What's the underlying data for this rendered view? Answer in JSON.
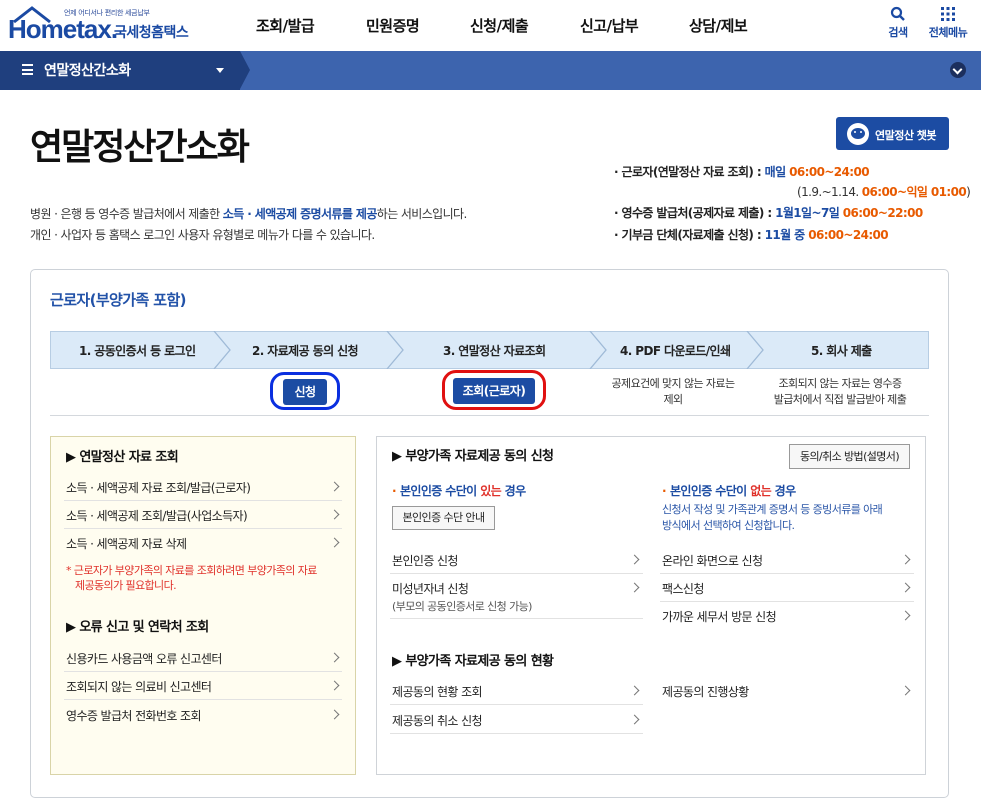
{
  "header": {
    "logo_small": "언제 어디서나 편리한 세금납부",
    "logo_brand": "Hometax.",
    "logo_kr": "국세청홈택스",
    "menu": [
      "조회/발급",
      "민원증명",
      "신청/제출",
      "신고/납부",
      "상담/제보"
    ],
    "search_label": "검색",
    "allmenu_label": "전체메뉴"
  },
  "nav": {
    "current": "연말정산간소화"
  },
  "page": {
    "title": "연말정산간소화",
    "chatbot_label": "연말정산 챗봇",
    "desc1_a": "병원 · 은행 등 영수증 발급처에서 제출한 ",
    "desc1_b": "소득 · 세액공제 증명서류를 제공",
    "desc1_c": "하는 서비스입니다.",
    "desc2": "개인 · 사업자 등 홈택스 로그인 사용자 유형별로 메뉴가 다를 수 있습니다."
  },
  "schedule": [
    {
      "label": "·  근로자(연말정산 자료 조회) : ",
      "when": "매일 ",
      "time": "06:00~24:00"
    },
    {
      "label": "(1.9.~1.14. ",
      "time": "06:00~익일 01:00",
      "end": ")"
    },
    {
      "label": "·  영수증 발급처(공제자료 제출) : ",
      "when": "1월1일~7일 ",
      "time": "06:00~22:00"
    },
    {
      "label": "·  기부금 단체(자료제출 신청) : ",
      "when": "11월 중 ",
      "time": "06:00~24:00"
    }
  ],
  "section": {
    "title": "근로자(부양가족 포함)",
    "steps": [
      "1. 공동인증서 등 로그인",
      "2. 자료제공 동의 신청",
      "3. 연말정산 자료조회",
      "4. PDF 다운로드/인쇄",
      "5. 회사 제출"
    ],
    "apply_button": "신청",
    "lookup_button": "조회(근로자)",
    "note4": [
      "공제요건에 맞지 않는 자료는",
      "제외"
    ],
    "note5": [
      "조회되지 않는 자료는 영수증",
      "발급처에서 직접 발급받아 제출"
    ]
  },
  "left_box": {
    "head1": "▶ 연말정산 자료 조회",
    "items1": [
      "소득 · 세액공제 자료 조회/발급(근로자)",
      "소득 · 세액공제 조회/발급(사업소득자)",
      "소득 · 세액공제 자료 삭제"
    ],
    "warn": [
      "*  근로자가 부양가족의 자료를 조회하려면 부양가족의 자료",
      "제공동의가 필요합니다."
    ],
    "head2": "▶ 오류 신고 및 연락처 조회",
    "items2": [
      "신용카드 사용금액 오류 신고센터",
      "조회되지 않는 의료비 신고센터",
      "영수증 발급처 전화번호 조회"
    ]
  },
  "right_box": {
    "head1": "▶ 부양가족 자료제공 동의 신청",
    "method_button": "동의/취소 방법(설명서)",
    "col1_head_a": "본인인증 수단이 ",
    "col1_head_b": "있는",
    "col1_head_c": " 경우",
    "col1_guide_button": "본인인증 수단 안내",
    "col1_items": [
      "본인인증 신청",
      "미성년자녀 신청"
    ],
    "col1_sub": "(부모의 공동인증서로 신청 가능)",
    "col2_head_a": "본인인증 수단이 ",
    "col2_head_b": "없는",
    "col2_head_c": " 경우",
    "col2_note": [
      "신청서 작성 및 가족관계 증명서 등 증빙서류를 아래",
      "방식에서 선택하여 신청합니다."
    ],
    "col2_items": [
      "온라인 화면으로 신청",
      "팩스신청",
      "가까운 세무서 방문 신청"
    ],
    "head2": "▶ 부양가족 자료제공 동의 현황",
    "status_left": [
      "제공동의 현황 조회",
      "제공동의 취소 신청"
    ],
    "status_right": [
      "제공동의 진행상황"
    ]
  },
  "colors": {
    "brand": "#1c4ca3",
    "nav": "#3d64ae",
    "accent_orange": "#e85a00",
    "ring_blue": "#0a2fe0",
    "ring_red": "#e01010"
  }
}
